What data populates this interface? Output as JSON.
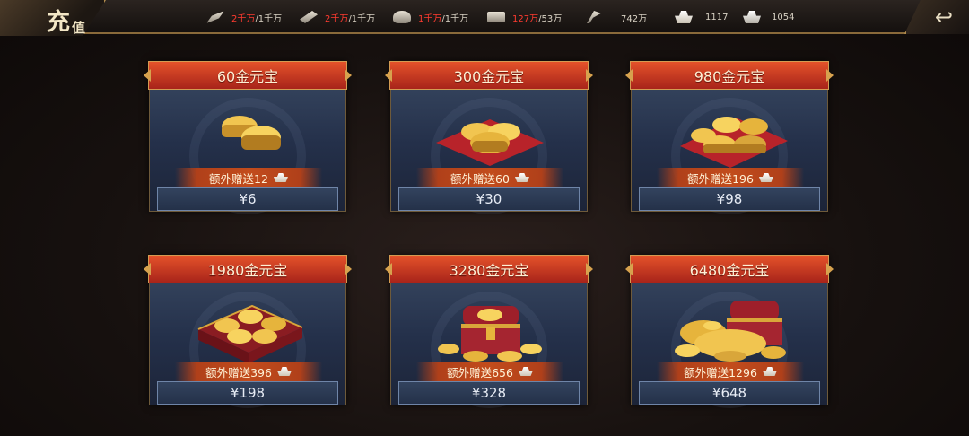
{
  "header": {
    "title_main": "充",
    "title_sub": "值",
    "resources": [
      {
        "icon": "grain-icon",
        "current": "2千万",
        "max": "/1千万",
        "value": ""
      },
      {
        "icon": "wood-icon",
        "current": "2千万",
        "max": "/1千万",
        "value": ""
      },
      {
        "icon": "stone-icon",
        "current": "1千万",
        "max": "/1千万",
        "value": ""
      },
      {
        "icon": "iron-icon",
        "current": "127万",
        "max": "/53万",
        "value": ""
      },
      {
        "icon": "mine-icon",
        "current": "",
        "max": "",
        "value": "742万"
      },
      {
        "icon": "gold-ingot-icon",
        "current": "",
        "max": "",
        "value": "1117"
      },
      {
        "icon": "silver-ingot-icon",
        "current": "",
        "max": "",
        "value": "1054"
      }
    ],
    "back_icon": "return-arrow-icon",
    "back_glyph": "↩"
  },
  "packages": [
    {
      "title": "60金元宝",
      "bonus": "额外赠送12",
      "price": "¥6"
    },
    {
      "title": "300金元宝",
      "bonus": "额外赠送60",
      "price": "¥30"
    },
    {
      "title": "980金元宝",
      "bonus": "额外赠送196",
      "price": "¥98"
    },
    {
      "title": "1980金元宝",
      "bonus": "额外赠送396",
      "price": "¥198"
    },
    {
      "title": "3280金元宝",
      "bonus": "额外赠送656",
      "price": "¥328"
    },
    {
      "title": "6480金元宝",
      "bonus": "额外赠送1296",
      "price": "¥648"
    }
  ],
  "colors": {
    "header_red": "#c23a1f",
    "gold": "#e2b54a",
    "card_blue": "#2c3a55",
    "amount_red": "#ff3b30"
  }
}
